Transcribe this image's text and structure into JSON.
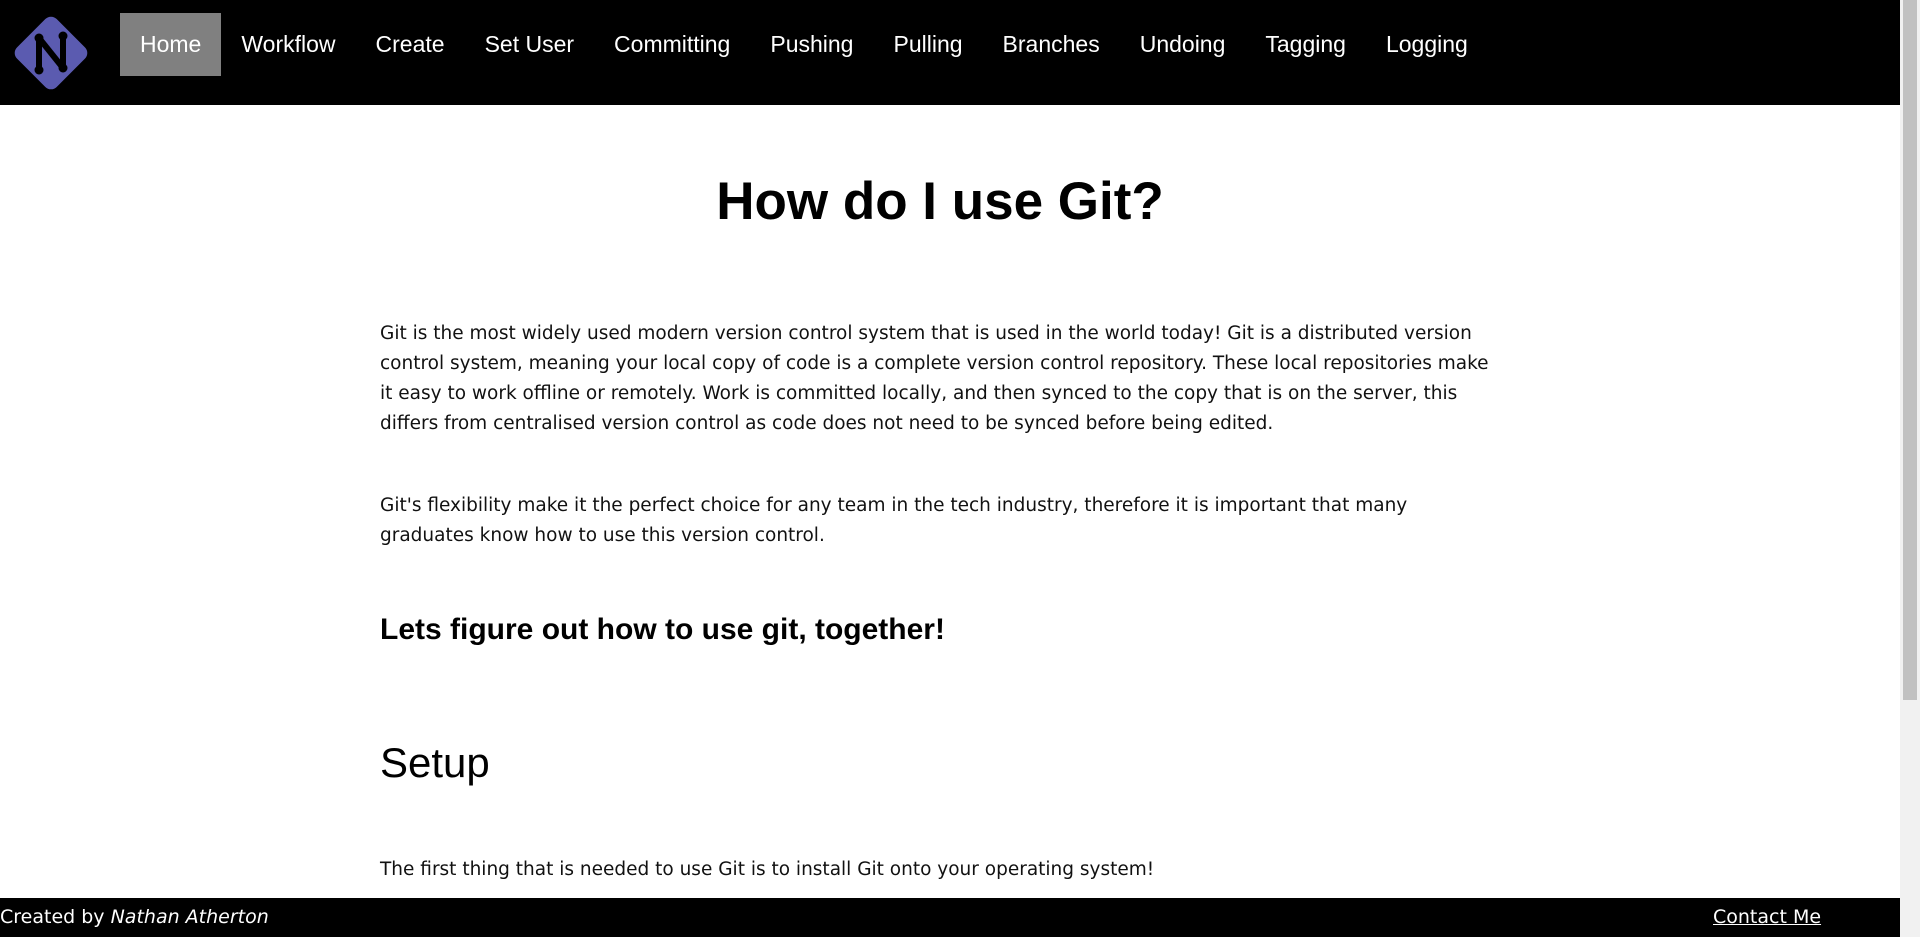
{
  "header": {
    "logo_icon": "n-diamond-logo-icon",
    "nav": [
      {
        "label": "Home",
        "active": true
      },
      {
        "label": "Workflow"
      },
      {
        "label": "Create"
      },
      {
        "label": "Set User"
      },
      {
        "label": "Committing"
      },
      {
        "label": "Pushing"
      },
      {
        "label": "Pulling"
      },
      {
        "label": "Branches"
      },
      {
        "label": "Undoing"
      },
      {
        "label": "Tagging"
      },
      {
        "label": "Logging"
      }
    ]
  },
  "main": {
    "title": "How do I use Git?",
    "paragraph1": "Git is the most widely used modern version control system that is used in the world today! Git is a distributed version control system, meaning your local copy of code is a complete version control repository. These local repositories make it easy to work offline or remotely. Work is committed locally, and then synced to the copy that is on the server, this differs from centralised version control as code does not need to be synced before being edited.",
    "paragraph2": "Git's flexibility make it the perfect choice for any team in the tech industry, therefore it is important that many graduates know how to use this version control.",
    "subheading": "Lets figure out how to use git, together!",
    "section_heading": "Setup",
    "paragraph3": "The first thing that is needed to use Git is to install Git onto your operating system!"
  },
  "footer": {
    "credit_prefix": "Created by",
    "credit_name": "Nathan Atherton",
    "contact_label": "Contact Me"
  },
  "colors": {
    "header_bg": "#000000",
    "nav_active_bg": "#808080",
    "logo_fill": "#5b5bb0"
  }
}
